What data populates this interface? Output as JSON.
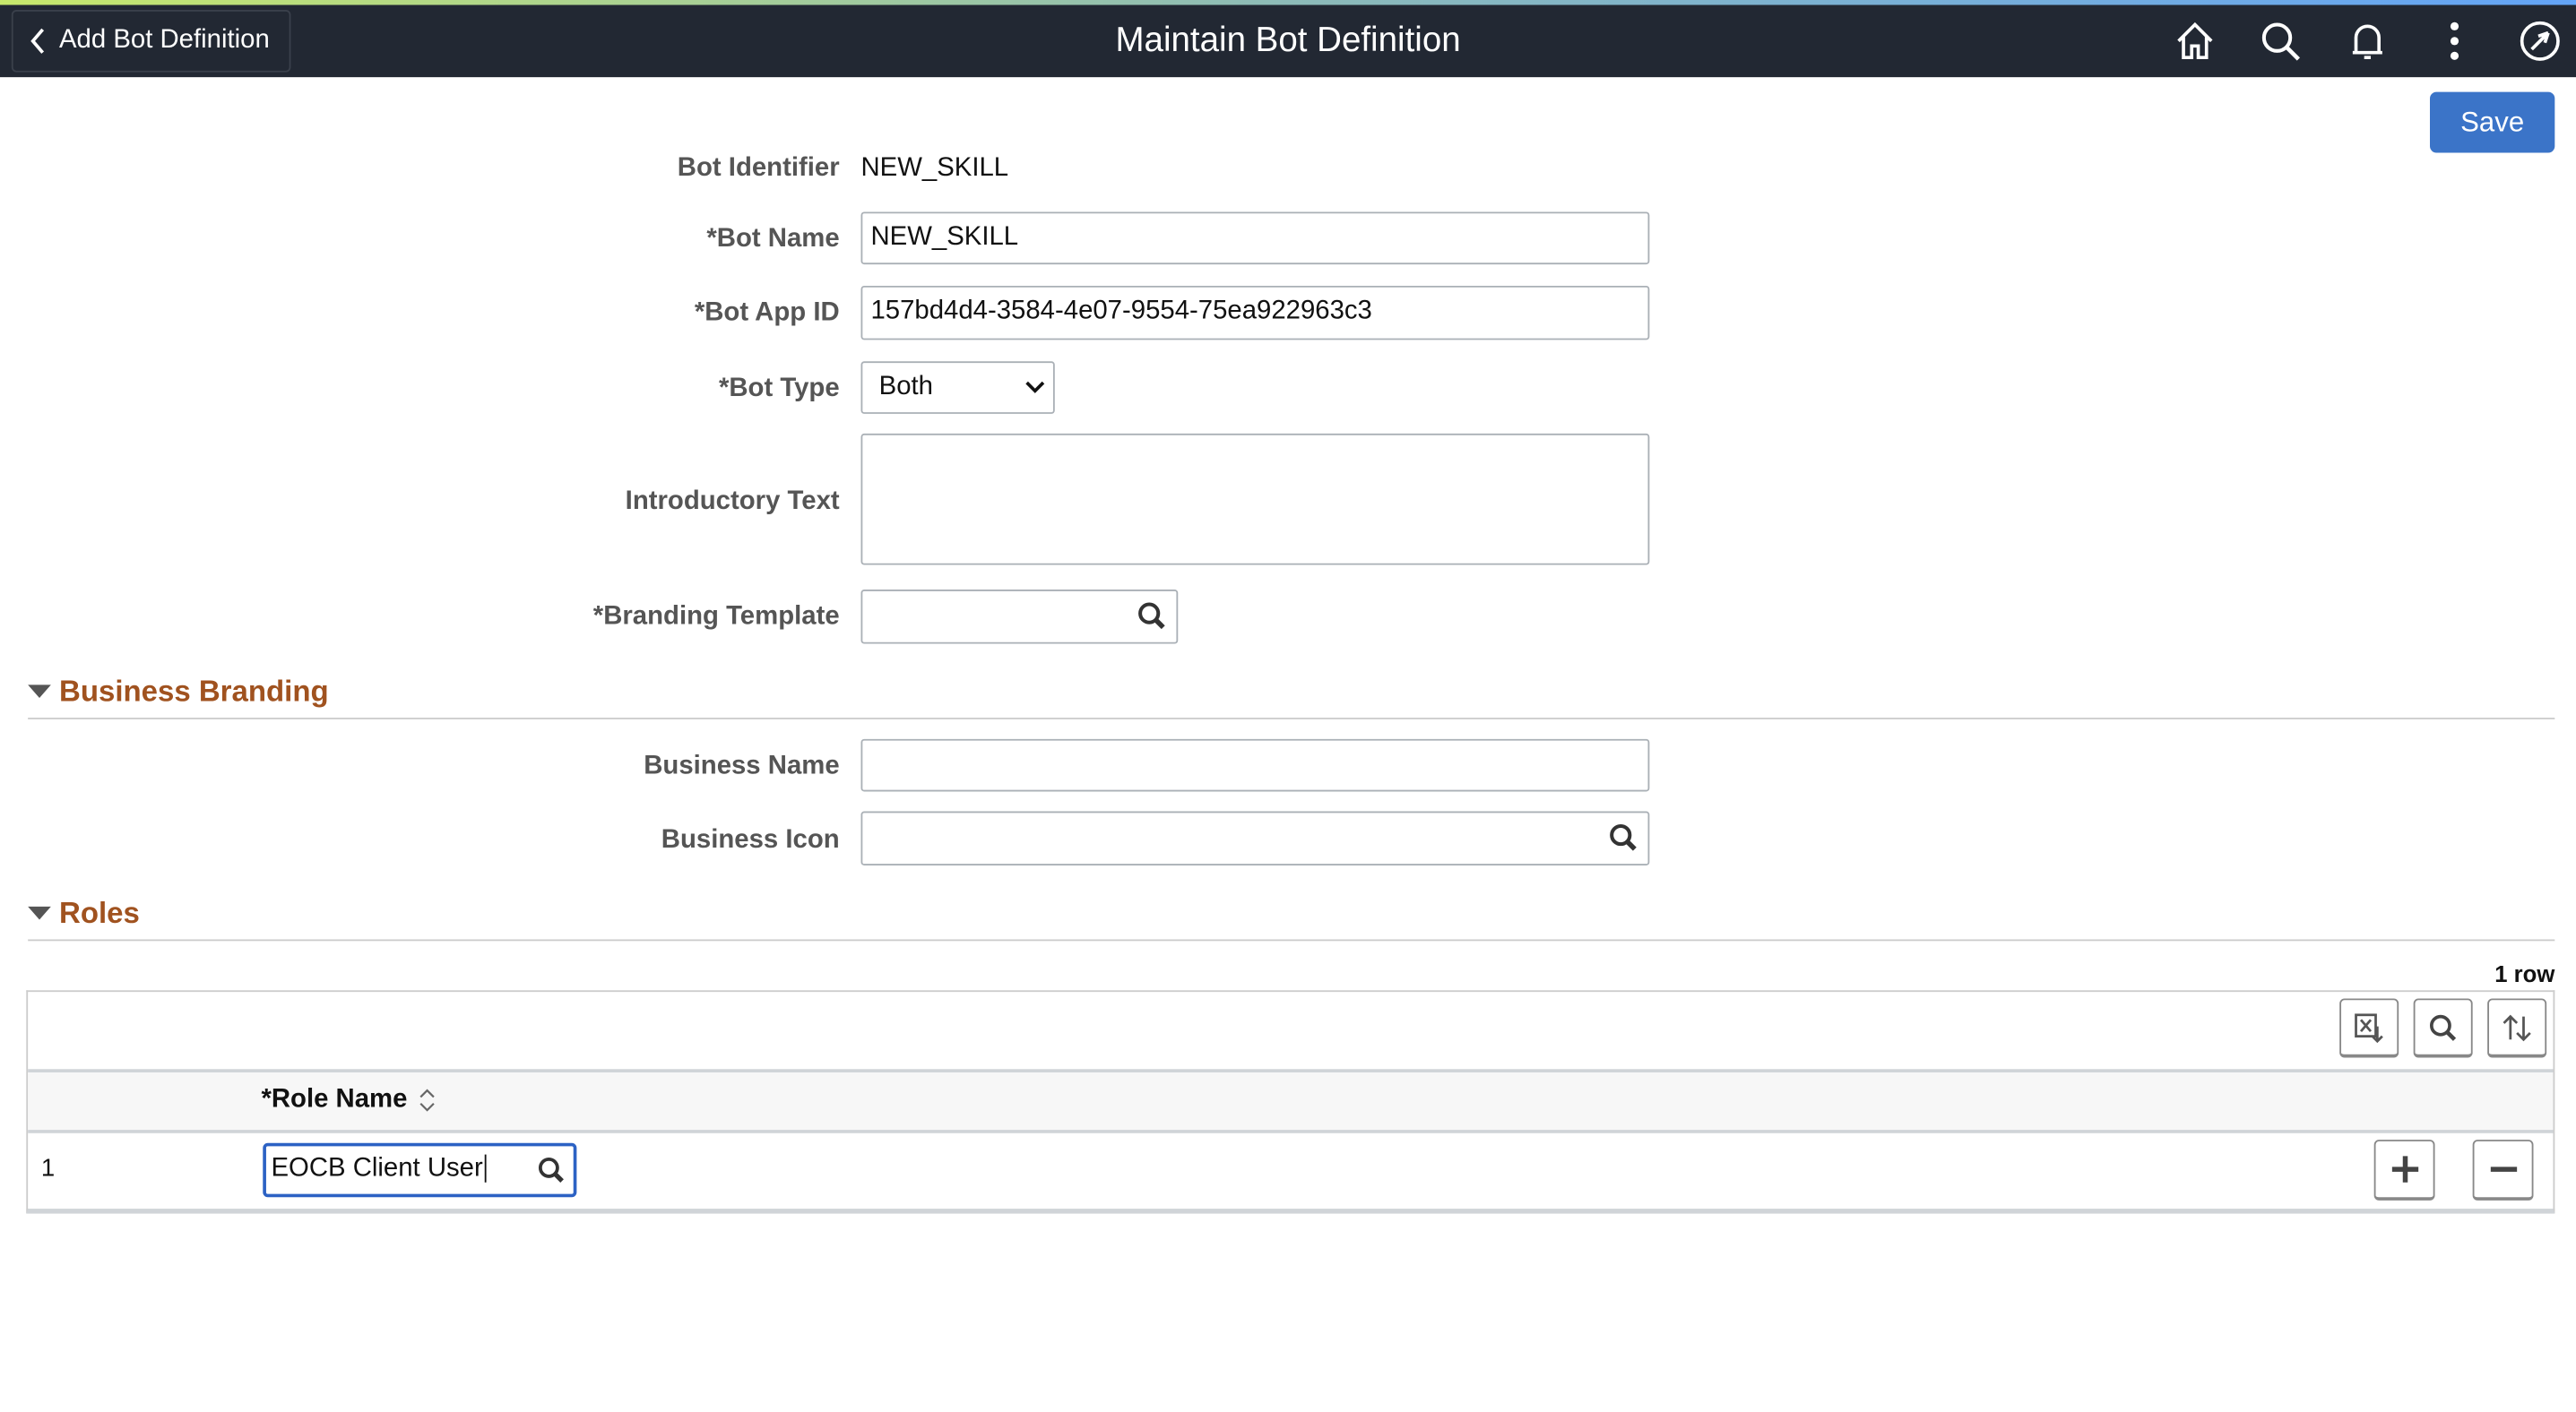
{
  "header": {
    "back_label": "Add Bot Definition",
    "title": "Maintain Bot Definition",
    "icons": [
      "home-icon",
      "search-icon",
      "bell-icon",
      "more-vertical-icon",
      "compass-icon"
    ]
  },
  "toolbar": {
    "save_label": "Save"
  },
  "form": {
    "bot_identifier": {
      "label": "Bot Identifier",
      "value": "NEW_SKILL"
    },
    "bot_name": {
      "label": "*Bot Name",
      "value": "NEW_SKILL"
    },
    "bot_app_id": {
      "label": "*Bot App ID",
      "value": "157bd4d4-3584-4e07-9554-75ea922963c3"
    },
    "bot_type": {
      "label": "*Bot Type",
      "value": "Both"
    },
    "intro_text": {
      "label": "Introductory Text",
      "value": ""
    },
    "branding_template": {
      "label": "*Branding Template",
      "value": ""
    }
  },
  "business_branding": {
    "title": "Business Branding",
    "business_name": {
      "label": "Business Name",
      "value": ""
    },
    "business_icon": {
      "label": "Business Icon",
      "value": ""
    }
  },
  "roles": {
    "title": "Roles",
    "row_count": "1 row",
    "column": "*Role Name",
    "rows": [
      {
        "num": "1",
        "role_name": "EOCB Client User"
      }
    ]
  }
}
